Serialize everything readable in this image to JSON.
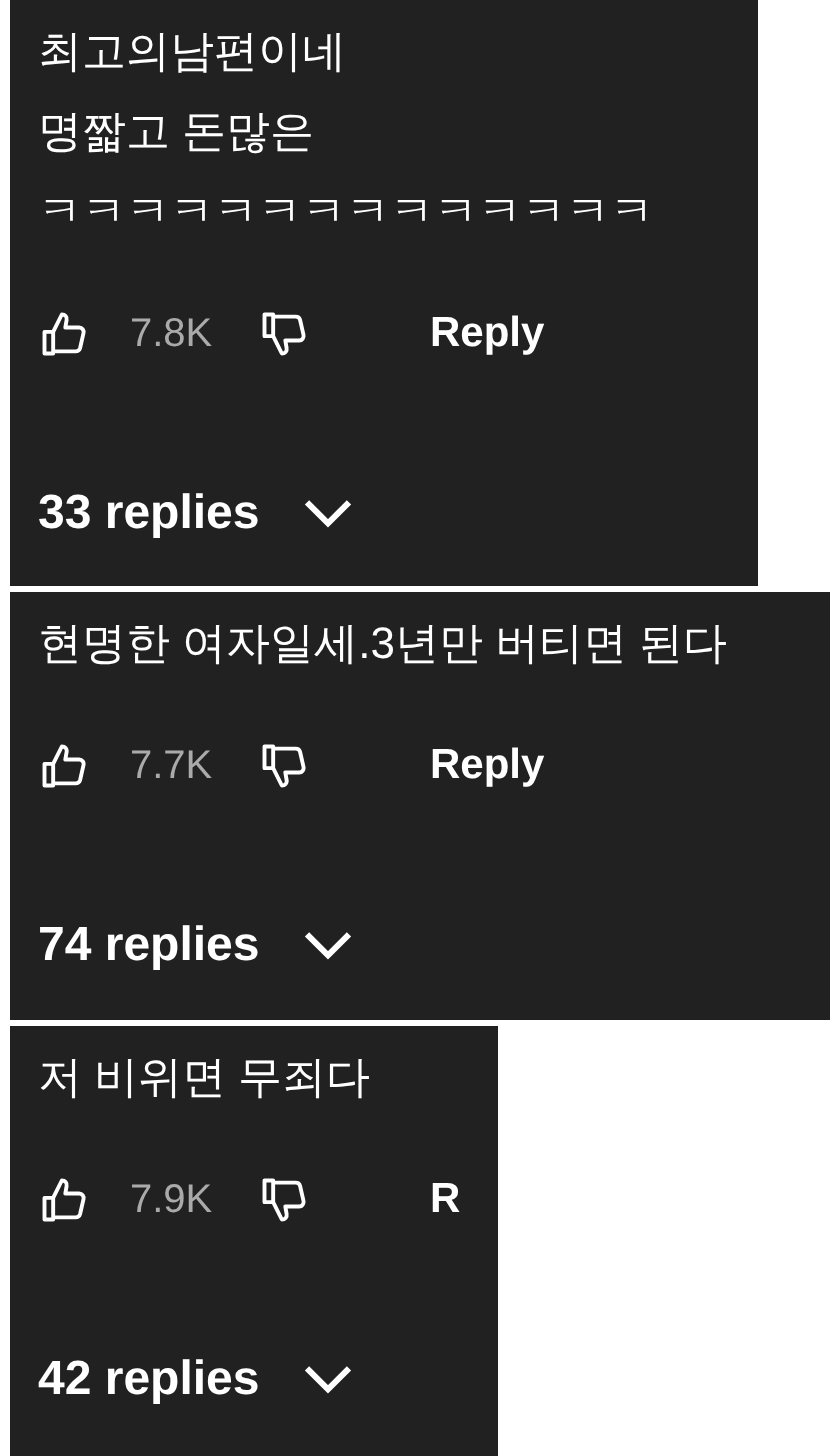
{
  "comments": [
    {
      "lines": [
        "최고의남편이네",
        "명짧고 돈많은",
        "ㅋㅋㅋㅋㅋㅋㅋㅋㅋㅋㅋㅋㅋㅋ"
      ],
      "likes": "7.8K",
      "reply": "Reply",
      "replies": "33 replies"
    },
    {
      "lines": [
        "현명한 여자일세.3년만 버티면 된다"
      ],
      "likes": "7.7K",
      "reply": "Reply",
      "replies": "74 replies"
    },
    {
      "lines": [
        "저 비위면 무죄다"
      ],
      "likes": "7.9K",
      "reply": "R",
      "replies": "42 replies"
    }
  ]
}
